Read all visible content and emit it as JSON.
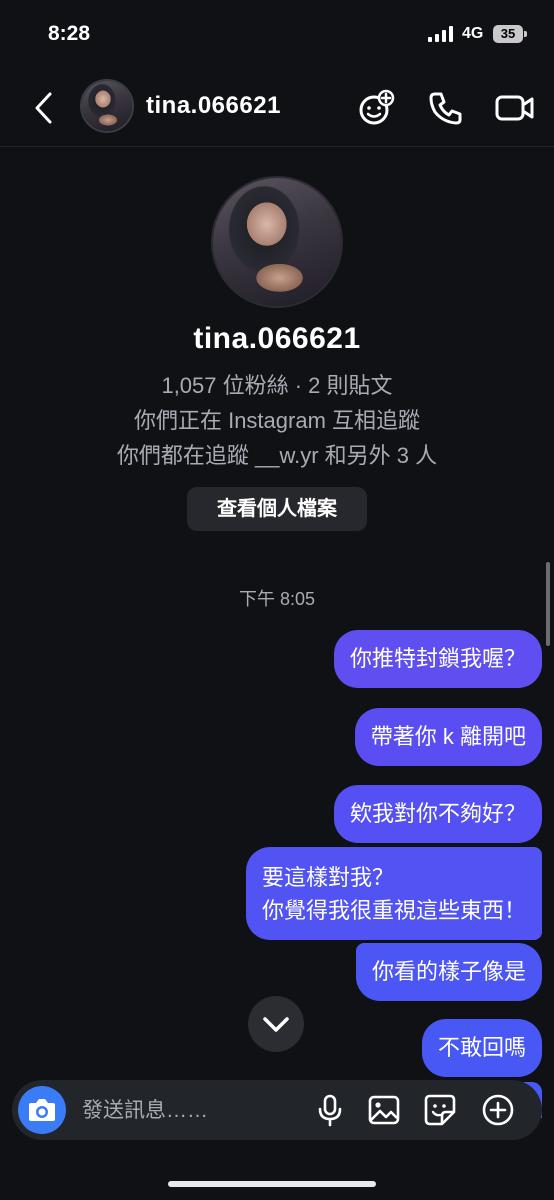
{
  "status_bar": {
    "time": "8:28",
    "network": "4G",
    "battery": "35"
  },
  "header": {
    "username": "tina.066621"
  },
  "profile": {
    "name": "tina.066621",
    "stats": "1,057 位粉絲 · 2 則貼文",
    "mutual_follow": "你們正在 Instagram 互相追蹤",
    "followed_by": "你們都在追蹤 __w.yr 和另外 3 人",
    "view_profile_label": "查看個人檔案"
  },
  "timestamp": "下午 8:05",
  "messages": [
    {
      "text": "你推特封鎖我喔？"
    },
    {
      "text": "帶著你 k 離開吧"
    },
    {
      "text": "欸我對你不夠好？"
    },
    {
      "lines": [
        "要這樣對我？",
        "你覺得我很重視這些東西！"
      ]
    },
    {
      "text": "你看的樣子像是"
    },
    {
      "text": "不敢回嗎"
    }
  ],
  "composer": {
    "placeholder": "發送訊息……"
  },
  "icons": {
    "back": "chevron-left-icon",
    "effects": "effects-sticker-icon",
    "call": "phone-icon",
    "video": "video-icon",
    "scroll_down": "chevron-down-icon",
    "camera": "camera-icon",
    "mic": "microphone-icon",
    "gallery": "image-icon",
    "sticker": "sticker-icon",
    "add": "plus-circle-icon"
  },
  "colors": {
    "accent": "#5f4ef0",
    "background": "#0f1115",
    "camera": "#3a7cf6"
  }
}
